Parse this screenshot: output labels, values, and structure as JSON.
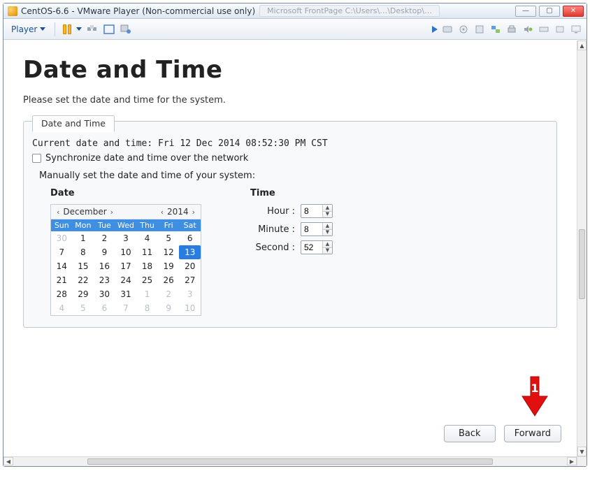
{
  "window": {
    "title": "CentOS-6.6 - VMware Player (Non-commercial use only)",
    "background_tab": "Microsoft FrontPage   C:\\Users\\…\\Desktop\\…"
  },
  "toolbar": {
    "player_label": "Player"
  },
  "page": {
    "heading": "Date and Time",
    "subtitle": "Please set the date and time for the system.",
    "tab_label": "Date and Time",
    "current_label": "Current date and time:",
    "current_value": "Fri 12 Dec 2014 08:52:30 PM CST",
    "sync_label": "Synchronize date and time over the network",
    "manual_label": "Manually set the date and time of your system:",
    "date_heading": "Date",
    "time_heading": "Time"
  },
  "calendar": {
    "month": "December",
    "year": "2014",
    "dow": [
      "Sun",
      "Mon",
      "Tue",
      "Wed",
      "Thu",
      "Fri",
      "Sat"
    ],
    "grid": [
      {
        "d": 30,
        "out": true
      },
      {
        "d": 1
      },
      {
        "d": 2
      },
      {
        "d": 3
      },
      {
        "d": 4
      },
      {
        "d": 5
      },
      {
        "d": 6
      },
      {
        "d": 7
      },
      {
        "d": 8
      },
      {
        "d": 9
      },
      {
        "d": 10
      },
      {
        "d": 11
      },
      {
        "d": 12
      },
      {
        "d": 13,
        "sel": true
      },
      {
        "d": 14
      },
      {
        "d": 15
      },
      {
        "d": 16
      },
      {
        "d": 17
      },
      {
        "d": 18
      },
      {
        "d": 19
      },
      {
        "d": 20
      },
      {
        "d": 21
      },
      {
        "d": 22
      },
      {
        "d": 23
      },
      {
        "d": 24
      },
      {
        "d": 25
      },
      {
        "d": 26
      },
      {
        "d": 27
      },
      {
        "d": 28
      },
      {
        "d": 29
      },
      {
        "d": 30
      },
      {
        "d": 31
      },
      {
        "d": 1,
        "out": true
      },
      {
        "d": 2,
        "out": true
      },
      {
        "d": 3,
        "out": true
      },
      {
        "d": 4,
        "out": true
      },
      {
        "d": 5,
        "out": true
      },
      {
        "d": 6,
        "out": true
      },
      {
        "d": 7,
        "out": true
      },
      {
        "d": 8,
        "out": true
      },
      {
        "d": 9,
        "out": true
      },
      {
        "d": 10,
        "out": true
      }
    ]
  },
  "time": {
    "hour_label": "Hour :",
    "minute_label": "Minute :",
    "second_label": "Second :",
    "hour": "8",
    "minute": "8",
    "second": "52"
  },
  "buttons": {
    "back": "Back",
    "forward": "Forward"
  },
  "annotation": {
    "label": "1"
  }
}
